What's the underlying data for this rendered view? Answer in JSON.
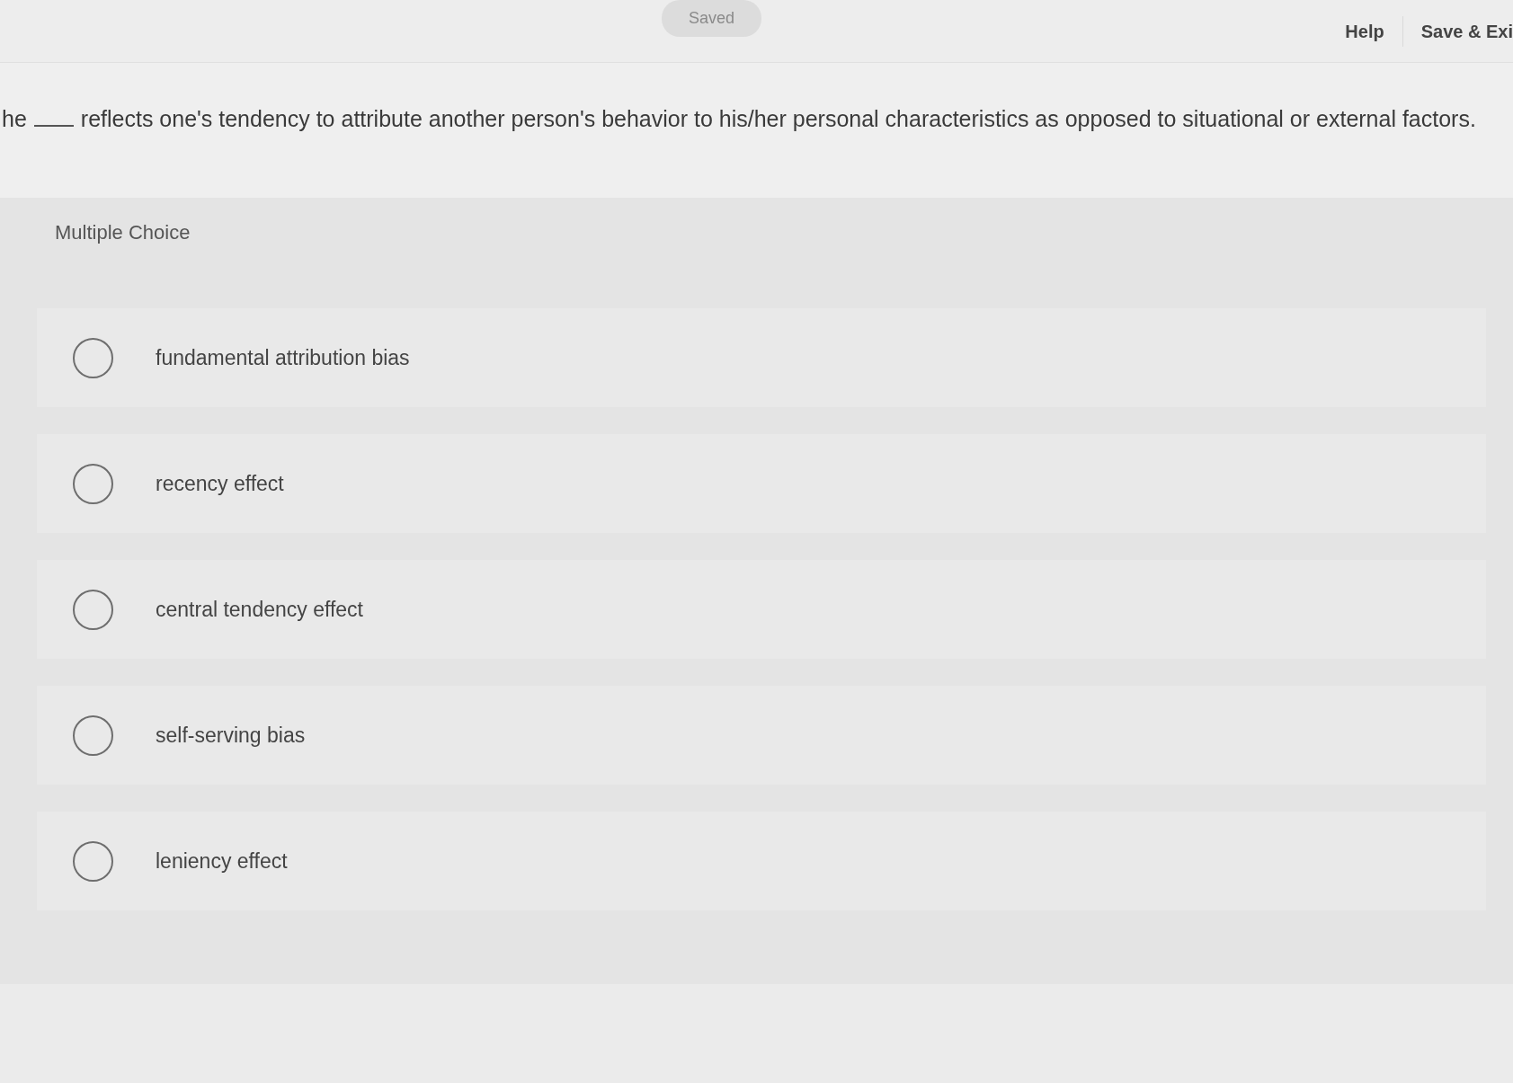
{
  "header": {
    "status": "Saved",
    "links": [
      "Help",
      "Save & Exi"
    ]
  },
  "question": {
    "start": "he",
    "rest": "reflects one's tendency to attribute another person's behavior to his/her personal characteristics as opposed to situational or external factors."
  },
  "answer_panel": {
    "type_label": "Multiple Choice",
    "options": [
      {
        "label": "fundamental attribution bias",
        "selected": false
      },
      {
        "label": "recency effect",
        "selected": false
      },
      {
        "label": "central tendency effect",
        "selected": false
      },
      {
        "label": "self-serving bias",
        "selected": false
      },
      {
        "label": "leniency effect",
        "selected": false
      }
    ]
  }
}
